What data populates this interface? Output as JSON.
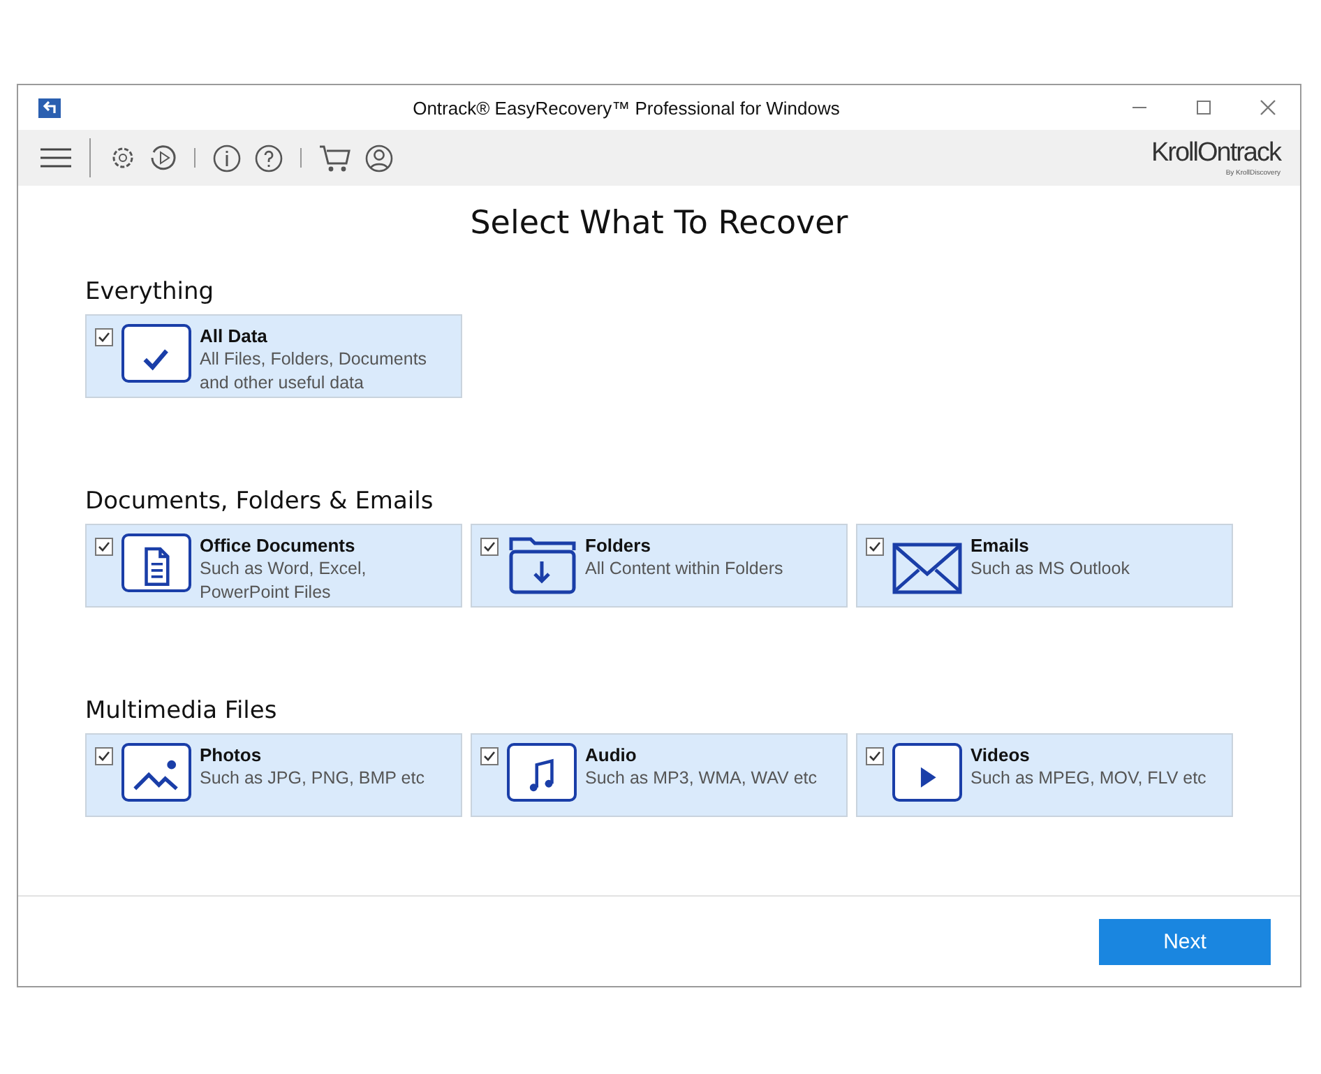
{
  "window": {
    "title": "Ontrack® EasyRecovery™ Professional for Windows"
  },
  "logo": {
    "name": "KrollOntrack",
    "tagline": "By KrollDiscovery"
  },
  "heading": "Select What To Recover",
  "sections": [
    {
      "title": "Everything",
      "cards": [
        {
          "kind": "check",
          "title": "All Data",
          "description": "All Files, Folders, Documents and other useful data",
          "checked": true
        }
      ]
    },
    {
      "title": "Documents, Folders & Emails",
      "cards": [
        {
          "kind": "document",
          "title": "Office Documents",
          "description": "Such as Word, Excel, PowerPoint Files",
          "checked": true
        },
        {
          "kind": "folder",
          "title": "Folders",
          "description": "All Content within Folders",
          "checked": true
        },
        {
          "kind": "mail",
          "title": "Emails",
          "description": "Such as MS Outlook",
          "checked": true
        }
      ]
    },
    {
      "title": "Multimedia Files",
      "cards": [
        {
          "kind": "photo",
          "title": "Photos",
          "description": "Such as JPG, PNG, BMP etc",
          "checked": true
        },
        {
          "kind": "music",
          "title": "Audio",
          "description": "Such as MP3, WMA, WAV etc",
          "checked": true
        },
        {
          "kind": "video",
          "title": "Videos",
          "description": "Such as MPEG, MOV, FLV etc",
          "checked": true
        }
      ]
    }
  ],
  "buttons": [
    "Next"
  ]
}
